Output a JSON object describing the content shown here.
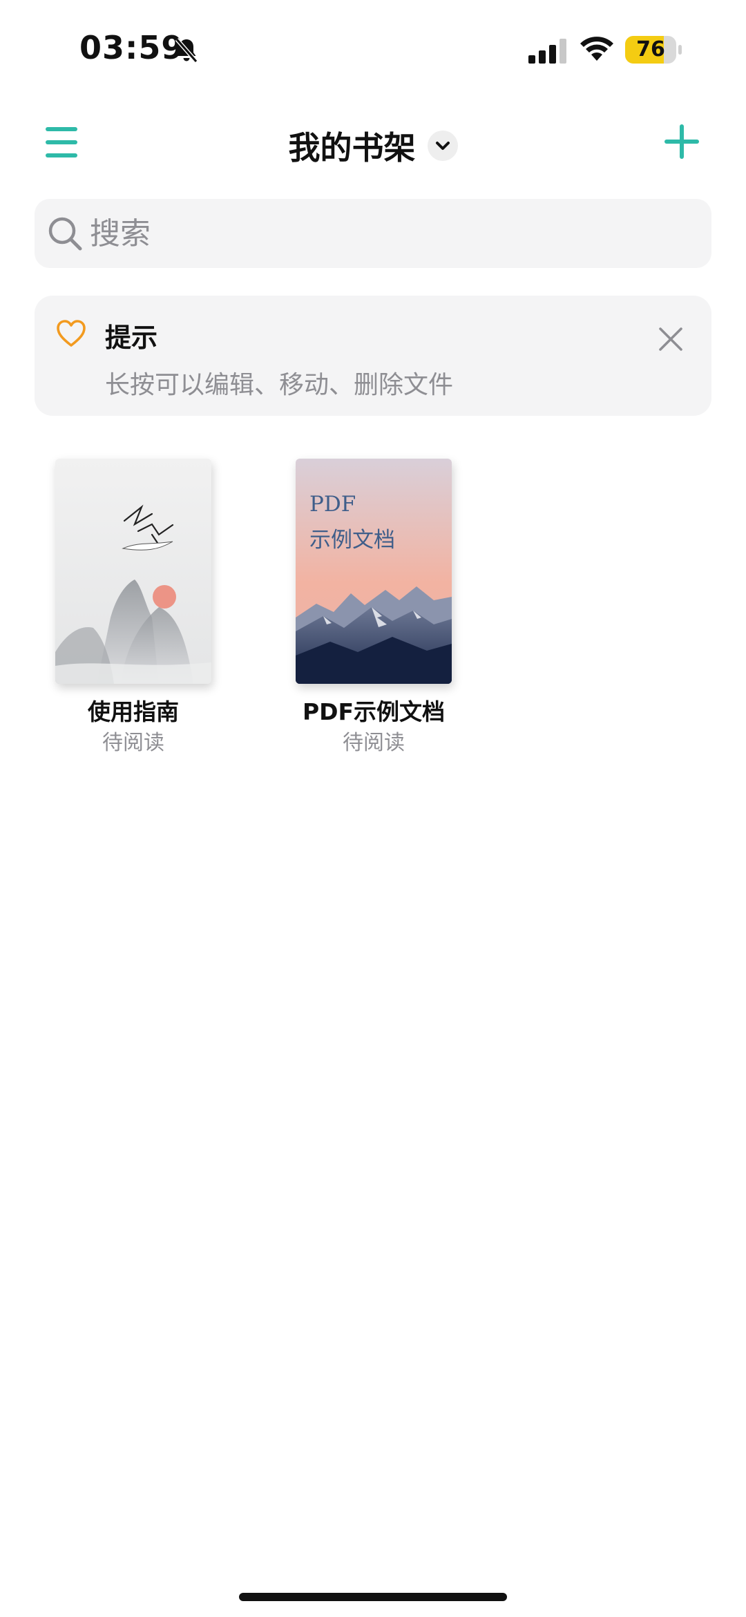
{
  "status_bar": {
    "time": "03:59",
    "battery": "76",
    "battery_level": 0.76,
    "icons": [
      "bell-off-icon",
      "signal-icon",
      "wifi-icon",
      "battery-icon"
    ]
  },
  "header": {
    "title": "我的书架",
    "menu_icon": "hamburger-menu-icon",
    "dropdown_icon": "chevron-down-icon",
    "add_icon": "plus-icon"
  },
  "search": {
    "placeholder": "搜索",
    "icon": "search-icon"
  },
  "tip": {
    "icon": "heart-icon",
    "title": "提示",
    "text": "长按可以编辑、移动、删除文件",
    "close_icon": "close-icon"
  },
  "books": [
    {
      "title": "使用指南",
      "status": "待阅读"
    },
    {
      "title": "PDF示例文档",
      "status": "待阅读",
      "cover_line1": "PDF",
      "cover_line2": "示例文档"
    }
  ],
  "colors": {
    "accent": "#2ebaa8",
    "heart": "#f29a1f",
    "battery": "#f4cc12",
    "muted_text": "#8e8e93",
    "card_bg": "#f4f4f5"
  }
}
